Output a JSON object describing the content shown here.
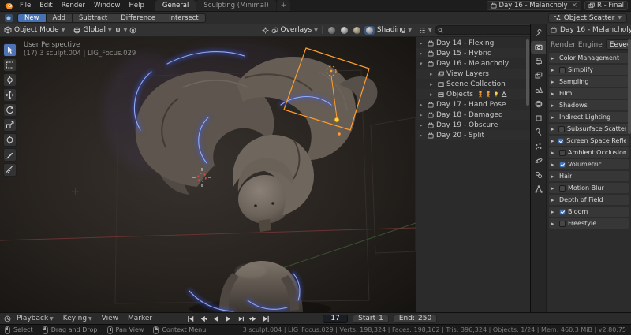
{
  "colors": {
    "accent_blue": "#4772b3",
    "selection_orange": "#ff9d2e",
    "glow_blue": "#8fa6ff",
    "clay_grey": "#665d55"
  },
  "app": {
    "menus": [
      "File",
      "Edit",
      "Render",
      "Window",
      "Help"
    ],
    "tabs": [
      {
        "label": "General",
        "active": true
      },
      {
        "label": "Sculpting (Minimal)",
        "active": false
      }
    ],
    "new_tab": "+",
    "scene": "Day 16 - Melancholy",
    "view_layer": "R - Final"
  },
  "toolbar": {
    "ops": [
      {
        "label": "New",
        "active": true
      },
      {
        "label": "Add",
        "active": false
      },
      {
        "label": "Subtract",
        "active": false
      },
      {
        "label": "Difference",
        "active": false
      },
      {
        "label": "Intersect",
        "active": false
      }
    ],
    "active_tool": "Object Scatter"
  },
  "viewport": {
    "header": {
      "mode": "Object Mode",
      "orientation": "Global",
      "overlays": "Overlays",
      "shading": "Shading"
    },
    "overlay": {
      "line1": "User Perspective",
      "line2": "(17) 3 sculpt.004 | LIG_Focus.029"
    }
  },
  "outliner": {
    "rows": [
      {
        "label": "Day 14 - Flexing",
        "expanded": false,
        "child": false
      },
      {
        "label": "Day 15 - Hybrid",
        "expanded": false,
        "child": false
      },
      {
        "label": "Day 16 - Melancholy",
        "expanded": true,
        "child": false
      },
      {
        "label": "View Layers",
        "expanded": false,
        "child": true
      },
      {
        "label": "Scene Collection",
        "expanded": false,
        "child": true
      },
      {
        "label": "Objects",
        "expanded": false,
        "child": true
      },
      {
        "label": "Day 17 - Hand Pose",
        "expanded": false,
        "child": false
      },
      {
        "label": "Day 18 - Damaged",
        "expanded": false,
        "child": false
      },
      {
        "label": "Day 19 - Obscure",
        "expanded": false,
        "child": false
      },
      {
        "label": "Day 20 - Split",
        "expanded": false,
        "child": false
      }
    ]
  },
  "properties": {
    "breadcrumb": "Day 16 - Melancholy",
    "engine_label": "Render Engine",
    "engine_value": "Eevee",
    "sections": [
      {
        "label": "Color Management",
        "has_checkbox": false,
        "checked": false
      },
      {
        "label": "Simplify",
        "has_checkbox": true,
        "checked": false
      },
      {
        "label": "Sampling",
        "has_checkbox": false,
        "checked": false
      },
      {
        "label": "Film",
        "has_checkbox": false,
        "checked": false
      },
      {
        "label": "Shadows",
        "has_checkbox": false,
        "checked": false
      },
      {
        "label": "Indirect Lighting",
        "has_checkbox": false,
        "checked": false
      },
      {
        "label": "Subsurface Scattering",
        "has_checkbox": true,
        "checked": false
      },
      {
        "label": "Screen Space Reflections",
        "has_checkbox": true,
        "checked": true
      },
      {
        "label": "Ambient Occlusion",
        "has_checkbox": true,
        "checked": false
      },
      {
        "label": "Volumetric",
        "has_checkbox": true,
        "checked": true
      },
      {
        "label": "Hair",
        "has_checkbox": false,
        "checked": false
      },
      {
        "label": "Motion Blur",
        "has_checkbox": true,
        "checked": false
      },
      {
        "label": "Depth of Field",
        "has_checkbox": false,
        "checked": false
      },
      {
        "label": "Bloom",
        "has_checkbox": true,
        "checked": true
      },
      {
        "label": "Freestyle",
        "has_checkbox": true,
        "checked": false
      }
    ]
  },
  "timeline": {
    "menus": [
      "Playback",
      "Keying",
      "View",
      "Marker"
    ],
    "frame": "17",
    "start_label": "Start",
    "start_value": "1",
    "end_label": "End:",
    "end_value": "250"
  },
  "status": {
    "hints": [
      {
        "label": "Select"
      },
      {
        "label": "Drag and Drop"
      },
      {
        "label": "Pan View"
      },
      {
        "label": "Context Menu"
      }
    ],
    "stats": "3 sculpt.004 | LIG_Focus.029 | Verts: 198,324 | Faces: 198,162 | Tris: 396,324 | Objects: 1/24 | Mem: 460.3 MiB | v2.80.75"
  }
}
